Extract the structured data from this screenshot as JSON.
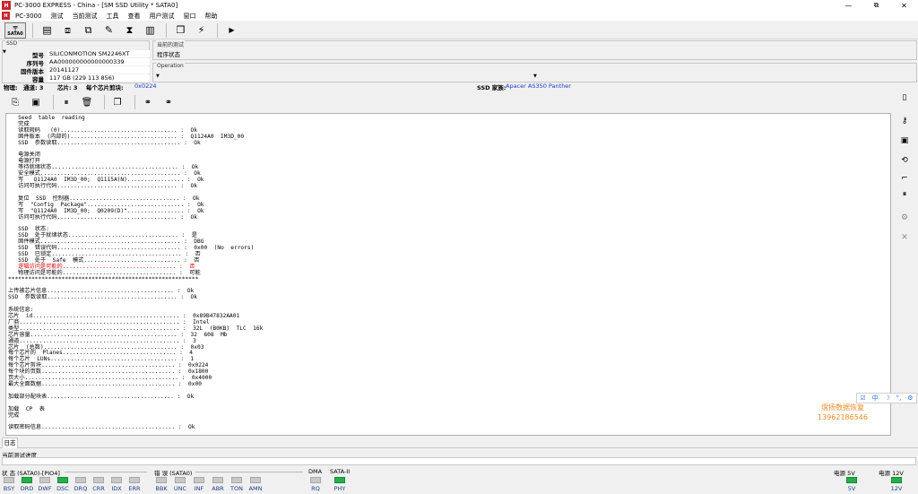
{
  "window": {
    "app_badge": "H",
    "title": "PC-3000 EXPRESS - China - [SM SSD Utility * SATA0]",
    "minimize": "—",
    "maximize": "⧉",
    "close": "✕"
  },
  "menu": [
    "PC-3000",
    "测试",
    "当前测试",
    "工具",
    "查看",
    "用户测试",
    "窗口",
    "帮助"
  ],
  "toolbar": {
    "active_label": "SATA0"
  },
  "ssd_panel": {
    "title": "SSD",
    "rows": [
      {
        "key": "型号",
        "value": "SILICONMOTION SM2246XT"
      },
      {
        "key": "序列号",
        "value": "AA000000000000000339"
      },
      {
        "key": "固件版本",
        "value": "20141127"
      },
      {
        "key": "容量",
        "value": "117 GB (229 113 856)"
      }
    ]
  },
  "current_test": {
    "title": "当前的测试",
    "value": "程序状态"
  },
  "operation": {
    "title": "Operation",
    "value": ""
  },
  "status_line": {
    "phys_label": "物理:",
    "channels": "通道: 3",
    "chips_prefix": "芯片: 3",
    "per_chip_label": "每个芯片剪块:",
    "per_chip_value": "0x0224",
    "family_label": "SSD 家族:",
    "family_value": "Apacer AS350 Panther"
  },
  "log": {
    "lines_before_red": "   Seed  table  reading\n   完成\n   读取瑕码   (0)................................... :  Ok\n   固件版本  (内部的)................................ :  Q1124A0  IM3D_00\n   SSD  参数读取..................................... :  Ok\n\n   电源关闭\n   电源打开\n   等待就绪状态...................................... :  Ok\n   安全模式.......................................... :  Ok\n   写   Q1124A0  IM3D_00;  Q1115A(N)................. :  Ok\n   访问可执行代码.................................... :  Ok\n\n   复位  SSD  控制器................................. :  Ok\n   写  \"Config  Package\"............................. :  Ok\n   写  \"Q1124A0  IM3D_00;  Q0209(D)\"................. :  Ok\n   访问可执行代码.................................... :  Ok\n\n   SSD  状态:\n   SSD  处于就绪状态................................. :  是\n   固件模式.......................................... :  DBG\n   SSD  错误代码..................................... :  0x00  (No  errors)\n   SSD  已锁定....................................... :  否\n   SSD  处于  Safe  模式............................. :  否",
    "red_line": "   逻辑访问是可能的.................................. :  否",
    "lines_after_red": "   物理访问是可能的.................................. :  可能\n*********************************************************\n\n上传被芯片信息...................................... :  Ok\nSSD  参数读取....................................... :  Ok\n\n系统信息:\n芯片  id............................................ :  0x89B47832AA01\n厂商................................................ :  Intel\n类型................................................ :  32L  (B0KB)  TLC  16k\n芯片容量............................................ :  32  608  Mb\n通道................................................ :  3\n芯片  (总数)........................................ :  0x03\n每个芯片的  Planes.................................. :  4\n每个芯片  LUNs...................................... :  1\n每个芯片剪块........................................ :  0x0224\n每个块的页数........................................ :  0x1800\n页大小.............................................. :  0x4000\n最大全面数据........................................ :  0x00\n\n加载部分配块表...................................... :  Ok\n\n加载  CP  表\n完成\n\n读取密码信息........................................ :  Ok"
  },
  "ime": [
    "☑",
    "中",
    "☽",
    "°,",
    "⚙"
  ],
  "watermark": {
    "line1": "熠扬数据恢复",
    "line2": "13962186546"
  },
  "tabs": {
    "log": "日志"
  },
  "progress": {
    "label": "当前测试进度"
  },
  "leds": {
    "status_label": "状 态 (SATA0)-[PIO4]",
    "status": [
      {
        "name": "BSY",
        "on": false
      },
      {
        "name": "DRD",
        "on": true
      },
      {
        "name": "DWF",
        "on": false
      },
      {
        "name": "DSC",
        "on": true
      },
      {
        "name": "DRQ",
        "on": false
      },
      {
        "name": "CRR",
        "on": false
      },
      {
        "name": "IDX",
        "on": false
      },
      {
        "name": "ERR",
        "on": false
      }
    ],
    "error_label": "错 误 (SATA0)",
    "errors": [
      {
        "name": "BBK",
        "on": false
      },
      {
        "name": "UNC",
        "on": false
      },
      {
        "name": "INF",
        "on": false
      },
      {
        "name": "ABR",
        "on": false
      },
      {
        "name": "TON",
        "on": false
      },
      {
        "name": "AMN",
        "on": false
      }
    ],
    "dma_label": "DMA",
    "dma": [
      {
        "name": "RQ",
        "on": false
      }
    ],
    "sata_label": "SATA-II",
    "sata": [
      {
        "name": "PHY",
        "on": true
      }
    ],
    "p5_label": "电源 5V",
    "p5": [
      {
        "name": "5V",
        "on": true
      }
    ],
    "p12_label": "电源 12V",
    "p12": [
      {
        "name": "12V",
        "on": true
      }
    ]
  }
}
